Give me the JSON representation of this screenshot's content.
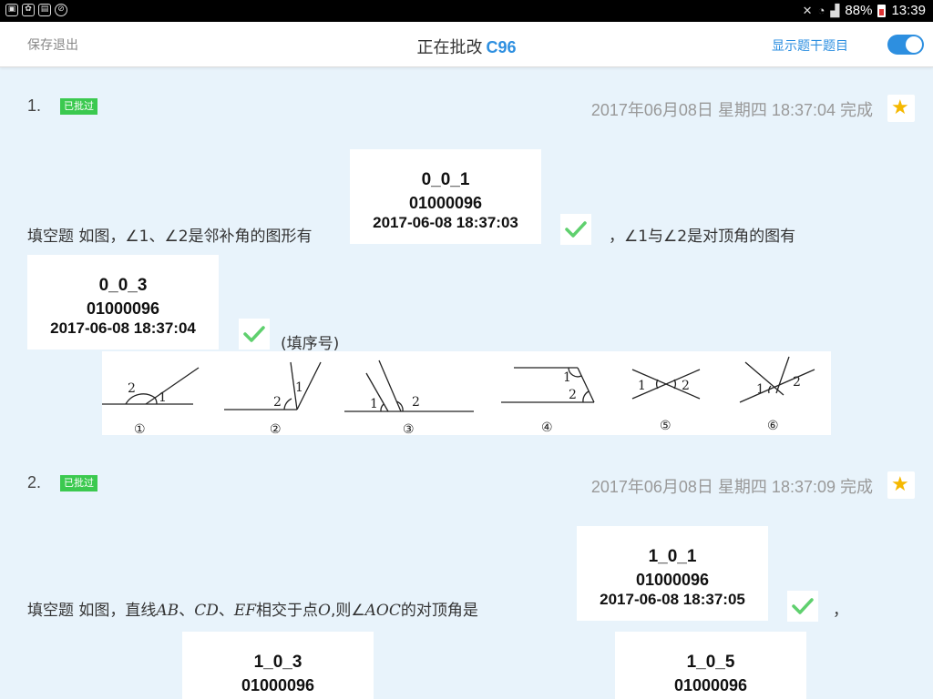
{
  "status_bar": {
    "battery": "88%",
    "time": "13:39"
  },
  "header": {
    "save_exit": "保存退出",
    "title_prefix": "正在批改",
    "title_code": "C96",
    "show_stem": "显示题干题目",
    "toggle_on": true
  },
  "questions": [
    {
      "number": "1.",
      "badge": "已批过",
      "time": "2017年06月08日 星期四 18:37:04 完成",
      "text_a_label": "填空题",
      "text_a": "如图，∠1、∠2是邻补角的图形有",
      "text_b": "，∠1与∠2是对顶角的图有",
      "text_c": "(填序号)",
      "answers": [
        {
          "code": "0_0_1",
          "id": "01000096",
          "time": "2017-06-08 18:37:03"
        },
        {
          "code": "0_0_3",
          "id": "01000096",
          "time": "2017-06-08 18:37:04"
        }
      ],
      "figure_labels": [
        "①",
        "②",
        "③",
        "④",
        "⑤",
        "⑥"
      ]
    },
    {
      "number": "2.",
      "badge": "已批过",
      "time": "2017年06月08日 星期四 18:37:09 完成",
      "text_a_label": "填空题",
      "text_a_1": "如图，直线",
      "text_a_2": "AB",
      "text_a_3": "、",
      "text_a_4": "CD",
      "text_a_5": "、",
      "text_a_6": "EF",
      "text_a_7": "相交于点",
      "text_a_8": "O",
      "text_a_9": ",则∠",
      "text_a_10": "AOC",
      "text_a_11": "的对顶角是",
      "text_b": "，",
      "answers": [
        {
          "code": "1_0_1",
          "id": "01000096",
          "time": "2017-06-08 18:37:05"
        },
        {
          "code": "1_0_3",
          "id": "01000096"
        },
        {
          "code": "1_0_5",
          "id": "01000096"
        }
      ]
    }
  ],
  "colors": {
    "accent": "#2d8fe0",
    "badge": "#3bc94f",
    "check": "#5fd06e",
    "star": "#f5b800",
    "page_bg": "#e8f3fb"
  }
}
